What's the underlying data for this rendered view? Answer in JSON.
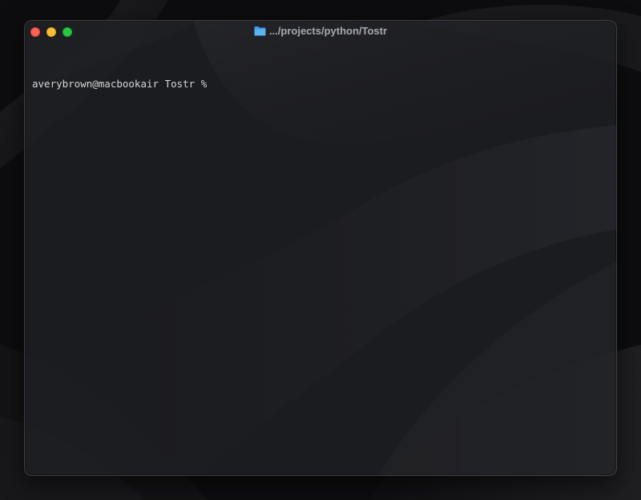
{
  "window": {
    "title": ".../projects/python/Tostr",
    "title_icon": "folder-icon"
  },
  "traffic_lights": {
    "close_color": "#fe5f57",
    "minimize_color": "#febc2e",
    "maximize_color": "#28c840"
  },
  "terminal": {
    "prompt": "averybrown@macbookair Tostr % "
  },
  "colors": {
    "window_background": "#1e1f23",
    "text": "#d8d8da",
    "folder_icon": "#3a9be8"
  }
}
